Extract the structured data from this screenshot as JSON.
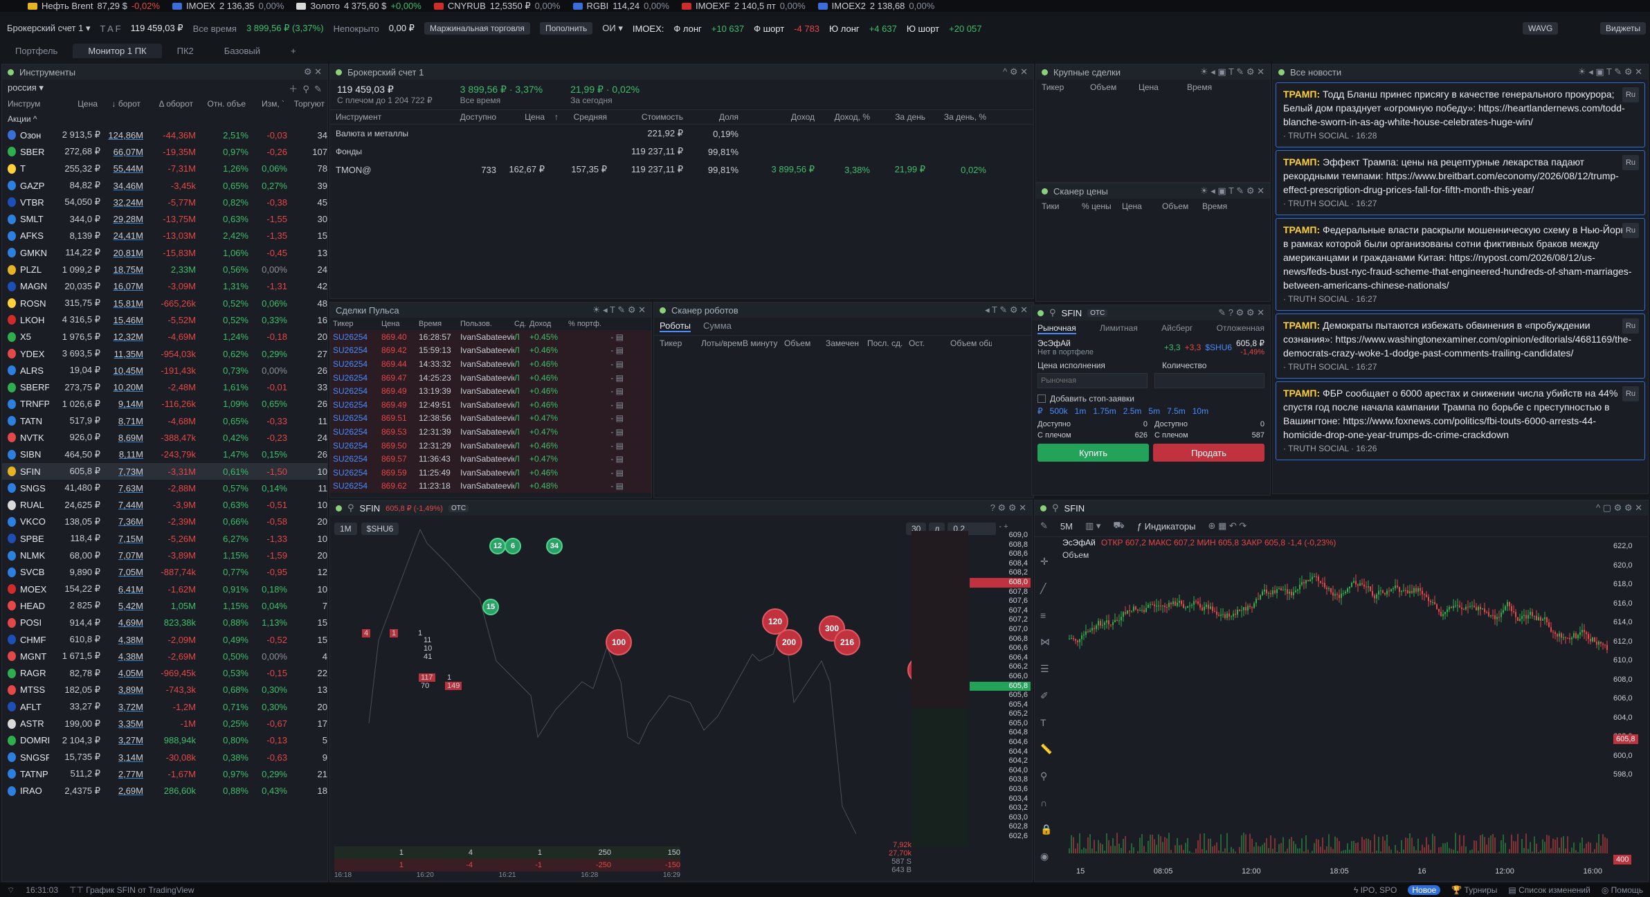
{
  "ticker": [
    {
      "name": "Нефть Brent",
      "price": "87,29 $",
      "chg": "-0,02%",
      "dir": "dn",
      "color": "#e6b422"
    },
    {
      "name": "IMOEX",
      "price": "2 136,35",
      "chg": "0,00%",
      "dir": "mut",
      "color": "#3b6ed8"
    },
    {
      "name": "Золото",
      "price": "4 375,60 $",
      "chg": "+0,00%",
      "dir": "up",
      "color": "#d9d9d9"
    },
    {
      "name": "CNYRUB",
      "price": "12,5350 ₽",
      "chg": "0,00%",
      "dir": "mut",
      "color": "#d12c2c"
    },
    {
      "name": "RGBI",
      "price": "114,24",
      "chg": "0,00%",
      "dir": "mut",
      "color": "#3b6ed8"
    },
    {
      "name": "IMOEXF",
      "price": "2 140,5 пт",
      "chg": "0,00%",
      "dir": "mut",
      "color": "#d12c2c"
    },
    {
      "name": "IMOEX2",
      "price": "2 138,68",
      "chg": "0,00%",
      "dir": "mut",
      "color": "#3b6ed8"
    }
  ],
  "topbar": {
    "account": "Брокерский счет 1",
    "modes": "T  A  F",
    "total": "119 459,03 ₽",
    "alltime_label": "Все время",
    "alltime": "3 899,56 ₽ (3,37%)",
    "unclosed_label": "Непокрыто",
    "unclosed": "0,00 ₽",
    "margin": "Маржинальная торговля",
    "topup": "Пополнить",
    "oi": "ОИ",
    "imoex_label": "IMOEX:",
    "f_long_label": "Ф лонг",
    "f_long": "+10 637",
    "f_short_label": "Ф шорт",
    "f_short": "-4 783",
    "u_long_label": "Ю лонг",
    "u_long": "+4 637",
    "u_short_label": "Ю шорт",
    "u_short": "+20 057",
    "wavg": "WAVG",
    "widgets": "Виджеты"
  },
  "tabs": [
    "Портфель",
    "Монитор 1 ПК",
    "ПК2",
    "Базовый",
    "+"
  ],
  "instruments": {
    "title": "Инструменты",
    "region": "россия",
    "cols": [
      "Инструм",
      "Цена",
      "↓ борот",
      "Δ оборот",
      "Отн. объе",
      "Изм, `",
      "Торгуют"
    ],
    "section": "Акции",
    "rows": [
      [
        "Озон",
        "2 913,5 ₽",
        "124,86M",
        "-44,36M",
        "2,51%",
        "-0,03",
        "34",
        "#3b6ed8"
      ],
      [
        "SBER",
        "272,68 ₽",
        "66,07M",
        "-19,35M",
        "0,97%",
        "-0,26",
        "107",
        "#2fae4e"
      ],
      [
        "T",
        "255,32 ₽",
        "55,44M",
        "-7,31M",
        "1,26%",
        "0,06%",
        "78",
        "#ffd23a"
      ],
      [
        "GAZP",
        "84,82 ₽",
        "34,46M",
        "-3,45k",
        "0,65%",
        "0,27%",
        "39",
        "#2d7fe0"
      ],
      [
        "VTBR",
        "54,050 ₽",
        "32,24M",
        "-5,77M",
        "0,82%",
        "-0,38",
        "45",
        "#1d4fb6"
      ],
      [
        "SMLT",
        "344,0 ₽",
        "29,28M",
        "-13,75M",
        "0,63%",
        "-1,55",
        "30",
        "#2d7fe0"
      ],
      [
        "AFKS",
        "8,139 ₽",
        "24,41M",
        "-13,03M",
        "2,42%",
        "-1,35",
        "15",
        "#2d7fe0"
      ],
      [
        "GMKN",
        "114,22 ₽",
        "20,81M",
        "-15,83M",
        "1,06%",
        "-0,45",
        "13",
        "#2d7fe0"
      ],
      [
        "PLZL",
        "1 099,2 ₽",
        "18,75M",
        "2,33M",
        "0,56%",
        "0,00%",
        "24",
        "#e6b422"
      ],
      [
        "MAGN",
        "20,035 ₽",
        "16,07M",
        "-3,09M",
        "1,31%",
        "-1,31",
        "42",
        "#1d4fb6"
      ],
      [
        "ROSN",
        "315,75 ₽",
        "15,81M",
        "-665,26k",
        "0,52%",
        "0,06%",
        "48",
        "#ffd23a"
      ],
      [
        "LKOH",
        "4 316,5 ₽",
        "15,46M",
        "-5,52M",
        "0,52%",
        "0,33%",
        "16",
        "#d12c2c"
      ],
      [
        "X5",
        "1 976,5 ₽",
        "12,32M",
        "-4,69M",
        "1,24%",
        "-0,18",
        "20",
        "#2fae4e"
      ],
      [
        "YDEX",
        "3 693,5 ₽",
        "11,35M",
        "-954,03k",
        "0,62%",
        "0,29%",
        "27",
        "#e54848"
      ],
      [
        "ALRS",
        "19,04 ₽",
        "10,45M",
        "-191,43k",
        "0,73%",
        "0,00%",
        "26",
        "#2d7fe0"
      ],
      [
        "SBERP",
        "273,75 ₽",
        "10,20M",
        "-2,48M",
        "1,61%",
        "-0,01",
        "33",
        "#2fae4e"
      ],
      [
        "TRNFP",
        "1 026,6 ₽",
        "9,14M",
        "-116,26k",
        "1,09%",
        "0,65%",
        "26",
        "#2d7fe0"
      ],
      [
        "TATN",
        "517,9 ₽",
        "8,71M",
        "-4,68M",
        "0,65%",
        "-0,33",
        "11",
        "#2d7fe0"
      ],
      [
        "NVTK",
        "926,0 ₽",
        "8,69M",
        "-388,47k",
        "0,42%",
        "-0,23",
        "24",
        "#e54848"
      ],
      [
        "SIBN",
        "464,50 ₽",
        "8,11M",
        "-243,79k",
        "1,47%",
        "0,15%",
        "26",
        "#2d7fe0"
      ],
      [
        "SFIN",
        "605,8 ₽",
        "7,73M",
        "-3,31M",
        "0,61%",
        "-1,50",
        "10",
        "#e6b422"
      ],
      [
        "SNGS",
        "41,480 ₽",
        "7,63M",
        "-2,88M",
        "0,57%",
        "0,14%",
        "11",
        "#2d7fe0"
      ],
      [
        "RUAL",
        "24,625 ₽",
        "7,44M",
        "-3,9M",
        "0,63%",
        "-0,51",
        "10",
        "#d9d9d9"
      ],
      [
        "VKCO",
        "138,05 ₽",
        "7,36M",
        "-2,39M",
        "0,66%",
        "-0,58",
        "20",
        "#2d7fe0"
      ],
      [
        "SPBE",
        "118,4 ₽",
        "7,15M",
        "-5,26M",
        "6,27%",
        "-1,33",
        "10",
        "#1d4fb6"
      ],
      [
        "NLMK",
        "68,00 ₽",
        "7,07M",
        "-3,89M",
        "1,15%",
        "-1,59",
        "20",
        "#2d7fe0"
      ],
      [
        "SVCB",
        "9,890 ₽",
        "7,05M",
        "-887,74k",
        "0,77%",
        "-0,95",
        "12",
        "#2d7fe0"
      ],
      [
        "MOEX",
        "154,22 ₽",
        "6,41M",
        "-1,62M",
        "0,91%",
        "0,18%",
        "10",
        "#d12c2c"
      ],
      [
        "HEAD",
        "2 825 ₽",
        "5,42M",
        "1,05M",
        "1,15%",
        "0,04%",
        "7",
        "#e54848"
      ],
      [
        "POSI",
        "914,4 ₽",
        "4,69M",
        "823,38k",
        "0,88%",
        "1,13%",
        "15",
        "#e54848"
      ],
      [
        "CHMF",
        "610,8 ₽",
        "4,38M",
        "-2,09M",
        "0,49%",
        "-0,52",
        "15",
        "#1d4fb6"
      ],
      [
        "MGNT",
        "1 671,5 ₽",
        "4,38M",
        "-2,69M",
        "0,50%",
        "0,00%",
        "4",
        "#e54848"
      ],
      [
        "RAGR",
        "82,78 ₽",
        "4,05M",
        "-969,45k",
        "0,53%",
        "-0,15",
        "22",
        "#2fae4e"
      ],
      [
        "MTSS",
        "182,05 ₽",
        "3,89M",
        "-743,3k",
        "0,68%",
        "0,30%",
        "13",
        "#e54848"
      ],
      [
        "AFLT",
        "33,27 ₽",
        "3,72M",
        "-1,2M",
        "0,71%",
        "0,30%",
        "20",
        "#1d4fb6"
      ],
      [
        "ASTR",
        "199,00 ₽",
        "3,35M",
        "-1M",
        "0,25%",
        "-0,67",
        "17",
        "#d9d9d9"
      ],
      [
        "DOMRF",
        "2 104,3 ₽",
        "3,27M",
        "988,94k",
        "0,80%",
        "-0,13",
        "5",
        "#2fae4e"
      ],
      [
        "SNGSP",
        "15,735 ₽",
        "3,14M",
        "-30,08k",
        "0,38%",
        "-0,63",
        "9",
        "#2d7fe0"
      ],
      [
        "TATNP",
        "511,2 ₽",
        "2,77M",
        "-1,67M",
        "0,97%",
        "0,29%",
        "21",
        "#2d7fe0"
      ],
      [
        "IRAO",
        "2,4375 ₽",
        "2,69M",
        "286,60k",
        "0,88%",
        "0,43%",
        "18",
        "#2d7fe0"
      ]
    ]
  },
  "broker": {
    "title": "Брокерский счет 1",
    "value": "119 459,03 ₽",
    "sub": "С плечом до 1 204 722 ₽",
    "alltime": "3 899,56 ₽ · 3,37%",
    "alltime_label": "Все время",
    "today": "21,99 ₽ · 0,02%",
    "today_label": "За сегодня",
    "cols": [
      "Инструмент",
      "Доступно",
      "Цена",
      "↑",
      "Средняя",
      "Стоимость",
      "Доля",
      "Доход",
      "Доход, %",
      "За день",
      "За день, %"
    ],
    "rows": [
      {
        "name": "Валюта и металлы",
        "cost": "221,92 ₽",
        "share": "0,19%"
      },
      {
        "name": "Фонды",
        "cost": "119 237,11 ₽",
        "share": "99,81%"
      },
      {
        "name": "TMON@",
        "avail": "733",
        "price": "162,67 ₽",
        "avg": "157,35 ₽",
        "cost": "119 237,11 ₽",
        "share": "99,81%",
        "income": "3 899,56 ₽",
        "incomep": "3,38%",
        "day": "21,99 ₽",
        "dayp": "0,02%"
      }
    ]
  },
  "bigdeals": {
    "title": "Крупные сделки",
    "cols": [
      "Тикер",
      "Объем",
      "Цена",
      "Время"
    ]
  },
  "scanner": {
    "title": "Сканер цены",
    "cols": [
      "Тики",
      "% цены",
      "Цена",
      "Объем",
      "Время"
    ]
  },
  "news": {
    "title": "Все новости",
    "items": [
      {
        "head": "ТРАМП:",
        "text": " Тодд Бланш принес присягу в качестве генерального прокурора; Белый дом празднует «огромную победу»: https://heartlandernews.com/todd-blanche-sworn-in-as-ag-white-house-celebrates-huge-win/",
        "meta": "· TRUTH SOCIAL · 16:28",
        "tag": "Ru"
      },
      {
        "head": "ТРАМП:",
        "text": " Эффект Трампа: цены на рецептурные лекарства падают рекордными темпами: https://www.breitbart.com/economy/2026/08/12/trump-effect-prescription-drug-prices-fall-for-fifth-month-this-year/",
        "meta": "· TRUTH SOCIAL · 16:27",
        "tag": "Ru"
      },
      {
        "head": "ТРАМП:",
        "text": " Федеральные власти раскрыли мошенническую схему в Нью-Йорке, в рамках которой были организованы сотни фиктивных браков между американцами и гражданами Китая: https://nypost.com/2026/08/12/us-news/feds-bust-nyc-fraud-scheme-that-engineered-hundreds-of-sham-marriages-between-americans-chinese-nationals/",
        "meta": "· TRUTH SOCIAL · 16:27",
        "tag": "Ru"
      },
      {
        "head": "ТРАМП:",
        "text": " Демократы пытаются избежать обвинения в «пробуждении сознания»: https://www.washingtonexaminer.com/opinion/editorials/4681169/the-democrats-crazy-woke-1-dodge-past-comments-trailing-candidates/",
        "meta": "· TRUTH SOCIAL · 16:27",
        "tag": "Ru"
      },
      {
        "head": "ТРАМП:",
        "text": " ФБР сообщает о 6000 арестах и снижении числа убийств на 44% спустя год после начала кампании Трампа по борьбе с преступностью в Вашингтоне: https://www.foxnews.com/politics/fbi-touts-6000-arrests-44-homicide-drop-one-year-trumps-dc-crime-crackdown",
        "meta": "· TRUTH SOCIAL · 16:26",
        "tag": "Ru"
      }
    ]
  },
  "pulse": {
    "title": "Сделки Пульса",
    "cols": [
      "Тикер",
      "Цена",
      "Время",
      "Пользов.",
      "Сд.",
      "Доход",
      "% портф."
    ],
    "rows": [
      [
        "SU26254",
        "869.40",
        "16:28:57",
        "IvanSabateevic",
        "Л",
        "+0.45%"
      ],
      [
        "SU26254",
        "869.42",
        "15:59:13",
        "IvanSabateevic",
        "Л",
        "+0.46%"
      ],
      [
        "SU26254",
        "869.44",
        "14:33:32",
        "IvanSabateevic",
        "Л",
        "+0.46%"
      ],
      [
        "SU26254",
        "869.47",
        "14:25:23",
        "IvanSabateevic",
        "Л",
        "+0.46%"
      ],
      [
        "SU26254",
        "869.49",
        "13:19:39",
        "IvanSabateevic",
        "Л",
        "+0.46%"
      ],
      [
        "SU26254",
        "869.49",
        "12:49:51",
        "IvanSabateevic",
        "Л",
        "+0.46%"
      ],
      [
        "SU26254",
        "869.51",
        "12:38:56",
        "IvanSabateevic",
        "Л",
        "+0.47%"
      ],
      [
        "SU26254",
        "869.53",
        "12:31:39",
        "IvanSabateevic",
        "Л",
        "+0.47%"
      ],
      [
        "SU26254",
        "869.50",
        "12:31:29",
        "IvanSabateevic",
        "Л",
        "+0.46%"
      ],
      [
        "SU26254",
        "869.57",
        "11:36:43",
        "IvanSabateevic",
        "Л",
        "+0.47%"
      ],
      [
        "SU26254",
        "869.59",
        "11:25:49",
        "IvanSabateevic",
        "Л",
        "+0.46%"
      ],
      [
        "SU26254",
        "869.62",
        "11:23:18",
        "IvanSabateevic",
        "Л",
        "+0.48%"
      ]
    ]
  },
  "robots": {
    "title": "Сканер роботов",
    "tabs": [
      "Роботы",
      "Сумма"
    ],
    "cols": [
      "Тикер",
      "Лоты/время",
      "В минуту",
      "Объем",
      "Замечен",
      "Посл. сд.",
      "Ост.",
      "Объем общий"
    ]
  },
  "order": {
    "ticker": "SFIN",
    "otc": "OTC",
    "tabs": [
      "Рыночная",
      "Лимитная",
      "Айсберг",
      "Отложенная"
    ],
    "name": "ЭсЭфАй",
    "hold": "Нет в портфеле",
    "badge1": "+3,3",
    "badge2": "+3,3",
    "symbol": "$SHU6",
    "price": "605,8 ₽",
    "chg": "-1,49%",
    "exec_label": "Цена исполнения",
    "qty_label": "Количество",
    "exec_placeholder": "Рыночная",
    "stop_label": "Добавить стоп-заявки",
    "presets": [
      "₽",
      "500k",
      "1m",
      "1.75m",
      "2.5m",
      "5m",
      "7.5m",
      "10m"
    ],
    "avail_label": "Доступно",
    "avail_l": "0",
    "avail_r": "0",
    "lever_label": "С плечом",
    "lever_l": "626",
    "lever_r": "587",
    "buy": "Купить",
    "sell": "Продать"
  },
  "tape": {
    "ticker": "SFIN",
    "price": "605,8 ₽ (-1,49%)",
    "otc": "OTC",
    "tf": "1М",
    "sym": "$SHU6",
    "n1": "30",
    "n2": "л",
    "n3": "0,2",
    "bubbles_red": [
      "100",
      "120",
      "200",
      "300",
      "216",
      "250",
      "150"
    ],
    "bubbles_green": [
      "12",
      "6",
      "34",
      "15"
    ],
    "levels": [
      "609,0",
      "608,8",
      "608,6",
      "608,4",
      "608,2",
      "608,0",
      "607,8",
      "607,6",
      "607,4",
      "607,2",
      "607,0",
      "606,8",
      "606,6",
      "606,4",
      "606,2",
      "606,0",
      "605,8",
      "605,6",
      "605,4",
      "605,2",
      "605,0",
      "604,8",
      "604,6",
      "604,4",
      "604,2",
      "604,0",
      "603,8",
      "603,6",
      "603,4",
      "603,2",
      "603,0",
      "602,8",
      "602,6"
    ],
    "left_vols": [
      "4",
      "1",
      "1",
      "11",
      "10",
      "41",
      "117",
      "70",
      "1",
      "149"
    ],
    "bottom_rows": [
      [
        "1",
        "4",
        "1",
        "250",
        "150"
      ],
      [
        "1",
        "-4",
        "-1",
        "-250",
        "-150"
      ]
    ],
    "times": [
      "16:18",
      "16:20",
      "16:21",
      "16:28",
      "16:29"
    ],
    "right_stats": [
      "7,92k",
      "27,70k",
      "587 S",
      "643 B"
    ]
  },
  "chart": {
    "ticker": "SFIN",
    "tf": "5M",
    "indicators": "Индикаторы",
    "name": "ЭсЭфАй",
    "ohlc": "ОТКР 607,2  МАКС 607,2  МИН 605,8  ЗАКР 605,8  -1,4 (-0,23%)",
    "vol": "Объем",
    "yticks": [
      "622,0",
      "620,0",
      "618,0",
      "616,0",
      "614,0",
      "612,0",
      "610,0",
      "608,0",
      "606,0",
      "604,0",
      "602,0",
      "600,0",
      "598,0"
    ],
    "xticks": [
      "15",
      "08:05",
      "12:00",
      "18:05",
      "16",
      "12:00",
      "16:00"
    ],
    "last": "605,8",
    "vlabel": "400"
  },
  "status": {
    "time": "16:31:03",
    "chartlink": "График SFIN от TradingView",
    "ipo": "IPO, SPO",
    "new": "Новое",
    "tour": "Турниры",
    "changes": "Список изменений",
    "help": "Помощь"
  }
}
